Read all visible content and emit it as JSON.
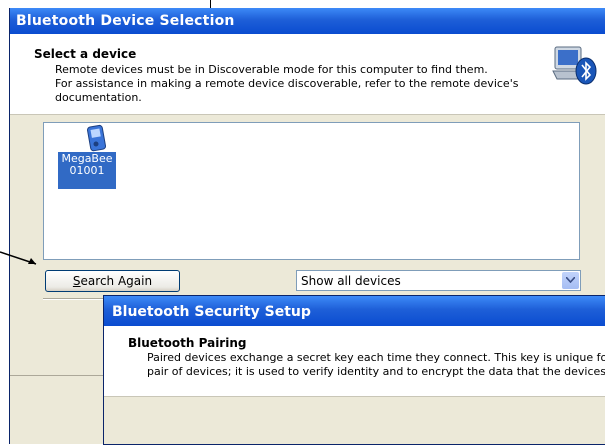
{
  "device_selection": {
    "window_title": "Bluetooth Device Selection",
    "header_title": "Select a device",
    "header_line1": "Remote devices must be in Discoverable mode for this computer to find them.",
    "header_line2": "For assistance in making a remote device discoverable, refer to the remote device's",
    "header_line3": "documentation.",
    "header_icon": "bluetooth-computer-icon",
    "device": {
      "name_line1": "MegaBee",
      "name_line2": "01001",
      "icon": "handheld-device-icon"
    },
    "search_button": {
      "prefix": "S",
      "rest": "earch Again"
    },
    "filter_select": {
      "value": "Show all devices"
    }
  },
  "security_setup": {
    "window_title": "Bluetooth Security Setup",
    "header_title": "Bluetooth Pairing",
    "header_line1": "Paired devices exchange a secret key each time they connect. This key is unique for ea",
    "header_line2": "pair of devices; it is used to verify identity and to encrypt the data that the devices excha"
  },
  "colors": {
    "title_bar": "#1e5fd8",
    "dialog_bg": "#ece9d8",
    "selection": "#316ac5"
  }
}
